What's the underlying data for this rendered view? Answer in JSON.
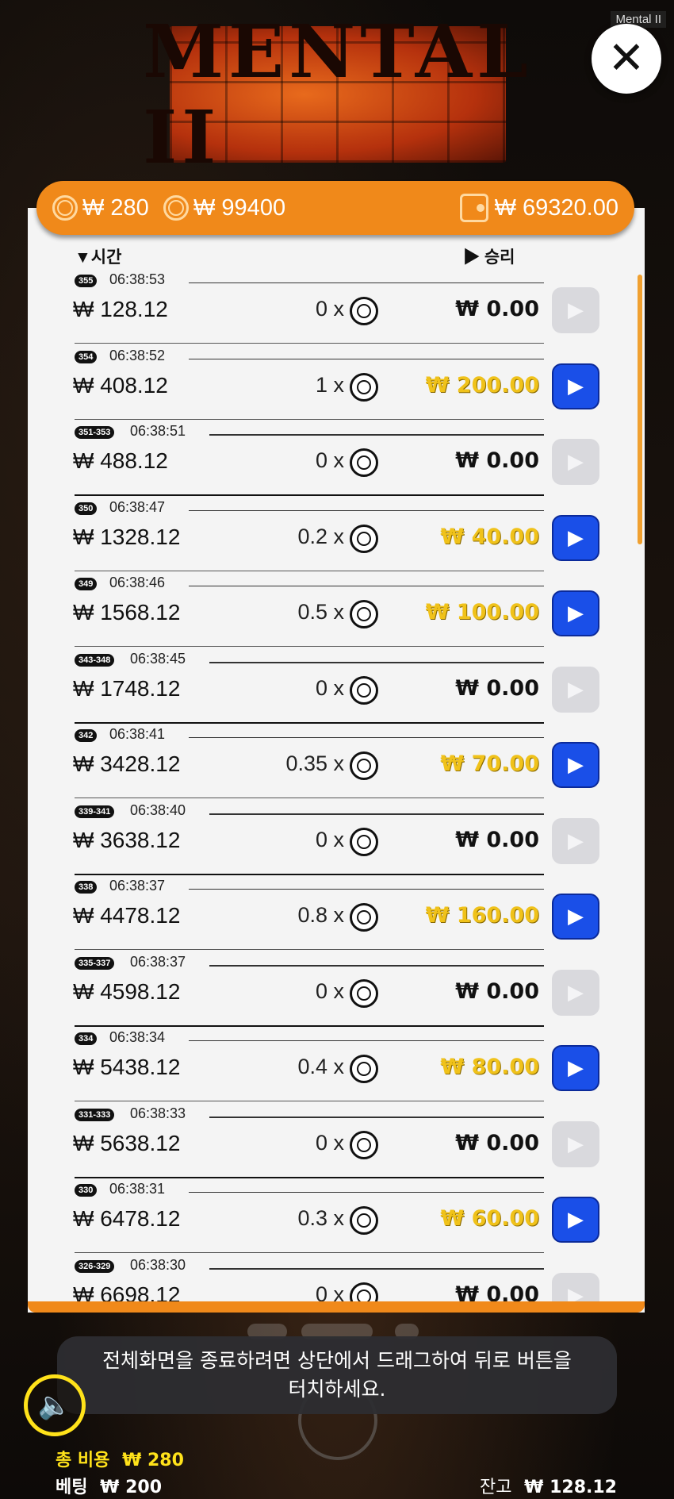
{
  "app_title": "Mental II",
  "logo_text": "MENTAL II",
  "close_icon": "✕",
  "header": {
    "bet_cost": "₩ 280",
    "coin_value": "₩ 99400",
    "wallet_total": "₩ 69320.00"
  },
  "columns": {
    "time": "▼시간",
    "win": "▶ 승리"
  },
  "rows": [
    {
      "round": "355",
      "time": "06:38:53",
      "balance": "₩ 128.12",
      "mult": "0 x",
      "win": "₩ 0.00",
      "paid": false
    },
    {
      "round": "354",
      "time": "06:38:52",
      "balance": "₩ 408.12",
      "mult": "1 x",
      "win": "₩ 200.00",
      "paid": true
    },
    {
      "round": "351-353",
      "time": "06:38:51",
      "balance": "₩ 488.12",
      "mult": "0 x",
      "win": "₩ 0.00",
      "paid": false
    },
    {
      "round": "350",
      "time": "06:38:47",
      "balance": "₩ 1328.12",
      "mult": "0.2 x",
      "win": "₩ 40.00",
      "paid": true
    },
    {
      "round": "349",
      "time": "06:38:46",
      "balance": "₩ 1568.12",
      "mult": "0.5 x",
      "win": "₩ 100.00",
      "paid": true
    },
    {
      "round": "343-348",
      "time": "06:38:45",
      "balance": "₩ 1748.12",
      "mult": "0 x",
      "win": "₩ 0.00",
      "paid": false
    },
    {
      "round": "342",
      "time": "06:38:41",
      "balance": "₩ 3428.12",
      "mult": "0.35 x",
      "win": "₩ 70.00",
      "paid": true
    },
    {
      "round": "339-341",
      "time": "06:38:40",
      "balance": "₩ 3638.12",
      "mult": "0 x",
      "win": "₩ 0.00",
      "paid": false
    },
    {
      "round": "338",
      "time": "06:38:37",
      "balance": "₩ 4478.12",
      "mult": "0.8 x",
      "win": "₩ 160.00",
      "paid": true
    },
    {
      "round": "335-337",
      "time": "06:38:37",
      "balance": "₩ 4598.12",
      "mult": "0 x",
      "win": "₩ 0.00",
      "paid": false
    },
    {
      "round": "334",
      "time": "06:38:34",
      "balance": "₩ 5438.12",
      "mult": "0.4 x",
      "win": "₩ 80.00",
      "paid": true
    },
    {
      "round": "331-333",
      "time": "06:38:33",
      "balance": "₩ 5638.12",
      "mult": "0 x",
      "win": "₩ 0.00",
      "paid": false
    },
    {
      "round": "330",
      "time": "06:38:31",
      "balance": "₩ 6478.12",
      "mult": "0.3 x",
      "win": "₩ 60.00",
      "paid": true
    },
    {
      "round": "326-329",
      "time": "06:38:30",
      "balance": "₩ 6698.12",
      "mult": "0 x",
      "win": "₩ 0.00",
      "paid": false
    }
  ],
  "toast": {
    "line1": "전체화면을 종료하려면 상단에서 드래그하여 뒤로 버튼을",
    "line2": "터치하세요."
  },
  "footer": {
    "total_cost_label": "총 비용",
    "total_cost_value": "₩ 280",
    "bet_label": "베팅",
    "bet_value": "₩ 200",
    "balance_label": "잔고",
    "balance_value": "₩ 128.12"
  },
  "colors": {
    "accent": "#f0891a",
    "win_gold": "#f0c21a",
    "play_blue": "#1a4fe8",
    "sound_yellow": "#ffe21a"
  },
  "icons": {
    "coin": "coin-icon",
    "wallet": "wallet-icon",
    "play": "play-icon",
    "sound": "speaker-icon",
    "close": "close-icon"
  }
}
